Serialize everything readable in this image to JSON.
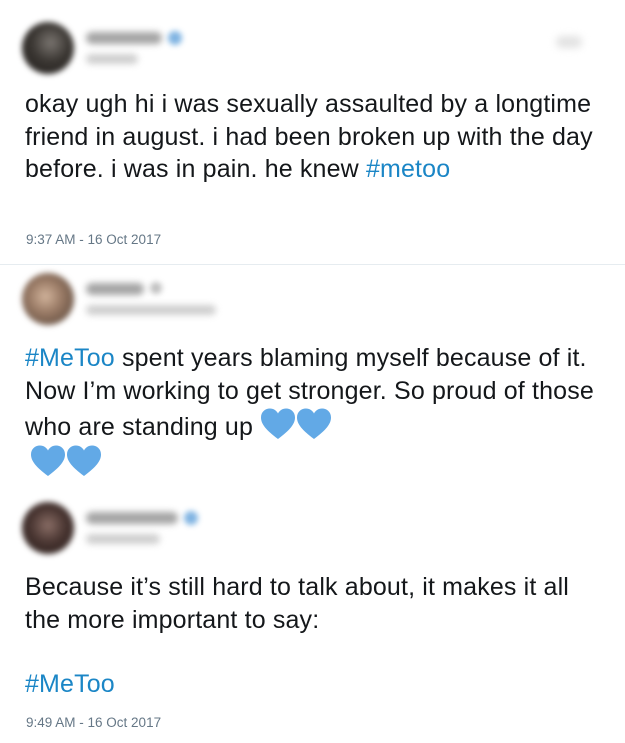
{
  "tweets": [
    {
      "body": "okay ugh hi i was sexually assaulted by a longtime friend in august. i had been broken up with the day before. i was in pain. he knew ",
      "hashtag": "#metoo",
      "timestamp": "9:37 AM - 16 Oct 2017"
    },
    {
      "hashtag": "#MeToo",
      "body": " spent years blaming myself because of it. Now I’m working to get stronger. So proud of those who are standing up ",
      "emoji_icons": [
        "blue-heart-icon",
        "blue-heart-icon",
        "blue-heart-icon",
        "blue-heart-icon"
      ]
    },
    {
      "body": "Because it’s still hard to talk about, it makes it all the more important to say:",
      "hashtag": "#MeToo",
      "timestamp": "9:49 AM - 16 Oct 2017"
    }
  ],
  "colors": {
    "text": "#14171a",
    "hashtag": "#1b86c6",
    "timestamp": "#657786",
    "heart": "#62a9e6",
    "divider": "#e6ecf0"
  }
}
